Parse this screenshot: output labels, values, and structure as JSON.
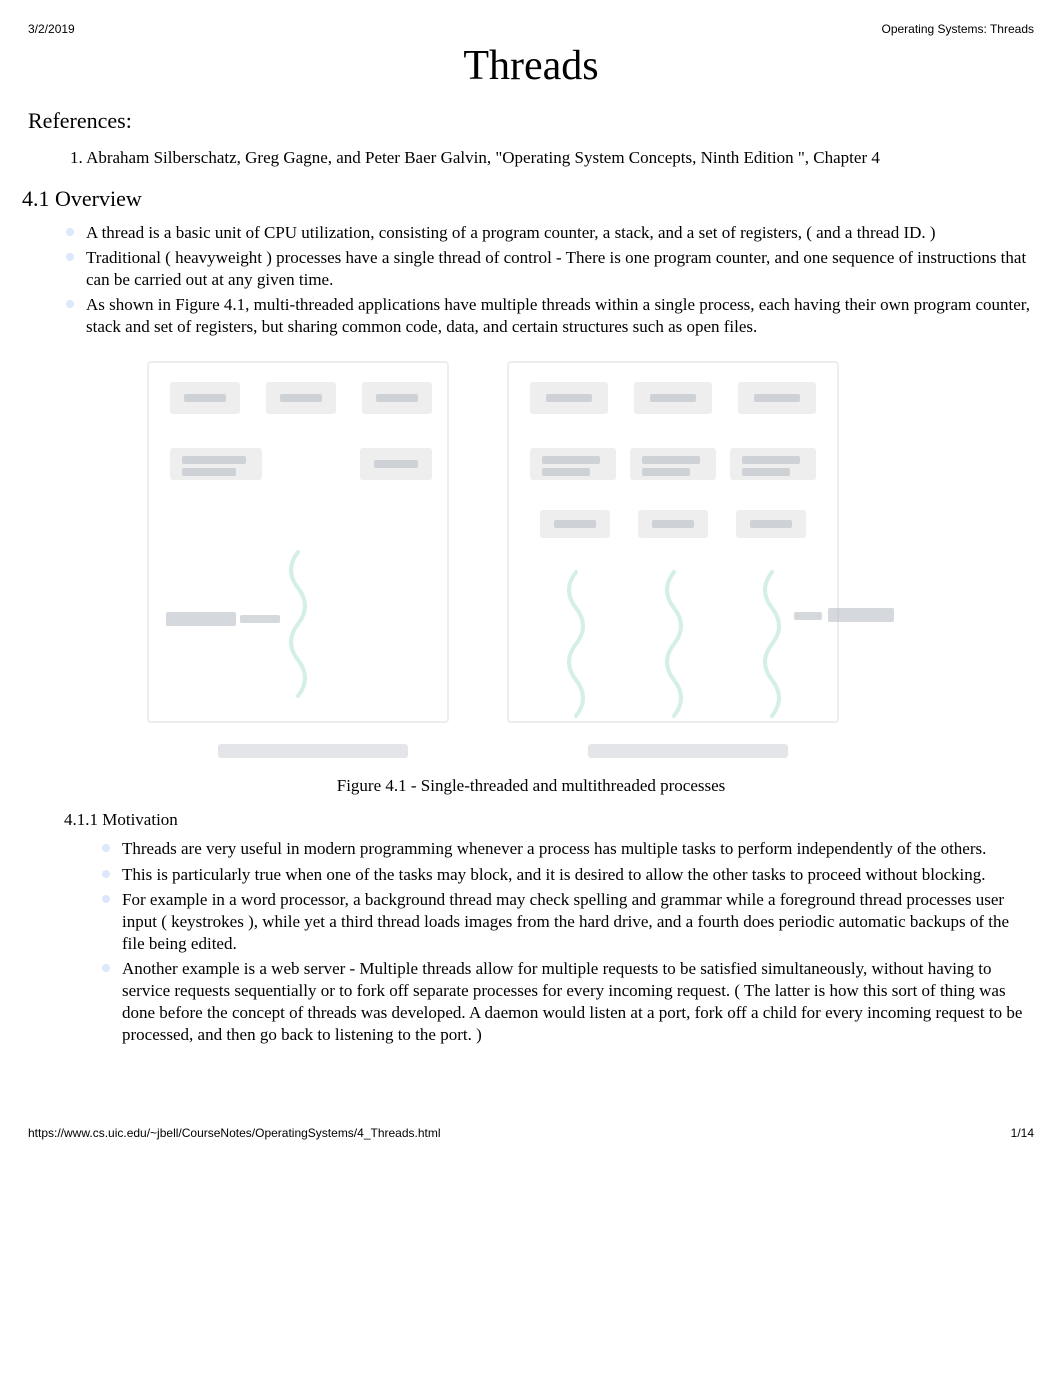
{
  "header": {
    "date": "3/2/2019",
    "doc_title": "Operating Systems: Threads"
  },
  "title": "Threads",
  "references_heading": "References:",
  "references": {
    "prefix": "1. ",
    "text": "Abraham Silberschatz, Greg Gagne, and Peter Baer Galvin, \"Operating System Concepts, Ninth Edition \", Chapter 4"
  },
  "section_4_1": {
    "heading": "4.1 Overview",
    "bullets": [
      "A thread is a basic unit of CPU utilization, consisting of a program counter, a stack, and a set of registers, ( and a thread ID. )",
      "Traditional ( heavyweight ) processes have a single thread of control - There is one program counter, and one sequence of instructions that can be carried out at any given time.",
      "As shown in Figure 4.1, multi-threaded applications have multiple threads within a single process, each having their own program counter, stack and set of registers, but sharing common code, data, and certain structures such as open files."
    ],
    "figure_caption": "Figure 4.1 - Single-threaded and multithreaded processes"
  },
  "section_4_1_1": {
    "heading": "4.1.1 Motivation",
    "bullets": [
      "Threads are very useful in modern programming whenever a process has multiple tasks to perform independently of the others.",
      "This is particularly true when one of the tasks may block, and it is desired to allow the other tasks to proceed without blocking.",
      "For example in a word processor, a background thread may check spelling and grammar while a foreground thread processes user input ( keystrokes ), while yet a third thread loads images from the hard drive, and a fourth does periodic automatic backups of the file being edited.",
      "Another example is a web server - Multiple threads allow for multiple requests to be satisfied simultaneously, without having to service requests sequentially or to fork off separate processes for every incoming request. ( The latter is how this sort of thing was done before the concept of threads was developed. A daemon would listen at a port, fork off a child for every incoming request to be processed, and then go back to listening to the port. )"
    ]
  },
  "footer": {
    "url": "https://www.cs.uic.edu/~jbell/CourseNotes/OperatingSystems/4_Threads.html",
    "page": "1/14"
  }
}
